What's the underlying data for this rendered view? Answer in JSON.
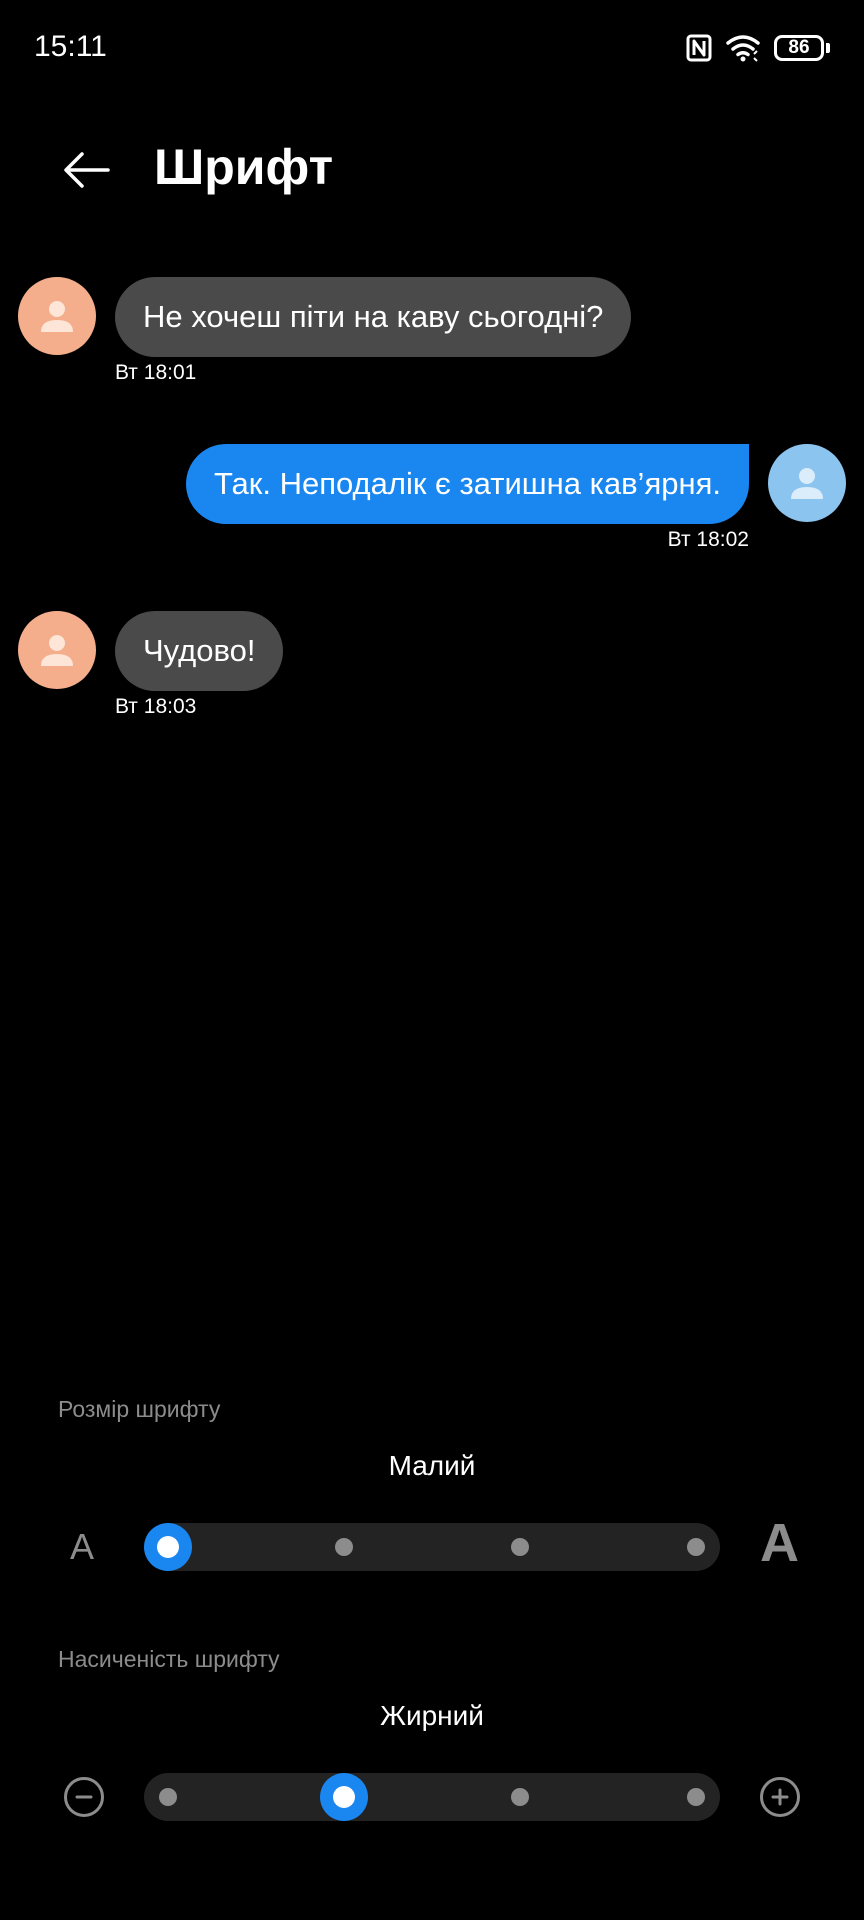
{
  "status_bar": {
    "time": "15:11",
    "battery": "86",
    "icons": [
      "nfc-icon",
      "wifi-icon",
      "battery-icon"
    ]
  },
  "header": {
    "title": "Шрифт",
    "back_icon": "arrow-left-icon"
  },
  "chat": {
    "messages": [
      {
        "direction": "incoming",
        "text": "Не хочеш піти на каву сьогодні?",
        "time": "Вт 18:01",
        "avatar_color": "#f4ae8c"
      },
      {
        "direction": "outgoing",
        "text": "Так. Неподалік є затишна кав’ярня.",
        "time": "Вт 18:02",
        "avatar_color": "#8cc4f0"
      },
      {
        "direction": "incoming",
        "text": "Чудово!",
        "time": "Вт 18:03",
        "avatar_color": "#f4ae8c"
      }
    ]
  },
  "font_size": {
    "label": "Розмір шрифту",
    "value": "Малий",
    "small_glyph": "A",
    "large_glyph": "A",
    "steps": 4,
    "selected_index": 0
  },
  "font_weight": {
    "label": "Насиченість шрифту",
    "value": "Жирний",
    "steps": 4,
    "selected_index": 1
  },
  "colors": {
    "accent": "#1a86f0",
    "incoming_bubble": "#4a4a4a",
    "background": "#000000"
  }
}
